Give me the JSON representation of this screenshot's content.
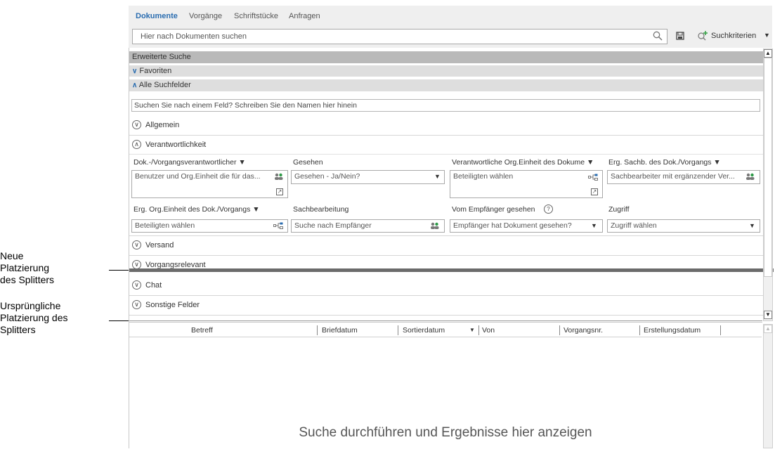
{
  "annotations": {
    "new_placement": [
      "Neue",
      "Platzierung",
      "des Splitters"
    ],
    "original_placement": [
      "Ursprüngliche",
      "Platzierung des",
      "Splitters"
    ]
  },
  "tabs": [
    "Dokumente",
    "Vorgänge",
    "Schriftstücke",
    "Anfragen"
  ],
  "active_tab": "Dokumente",
  "search": {
    "value": "Hier nach Dokumenten suchen",
    "criteria_label": "Suchkriterien"
  },
  "advanced": {
    "header": "Erweiterte Suche",
    "favorites": "Favoriten",
    "all_fields": "Alle Suchfelder",
    "field_search_value": "Suchen Sie nach einem Feld? Schreiben Sie den Namen hier hinein"
  },
  "sections": {
    "allgemein": "Allgemein",
    "verantwortlichkeit": "Verantwortlichkeit",
    "versand": "Versand",
    "vorgangsrelevant": "Vorgangsrelevant",
    "chat": "Chat",
    "sonstige": "Sonstige Felder"
  },
  "fields_row1": [
    {
      "label": "Dok.-/Vorgangsverantwortlicher ▼",
      "value": "Benutzer und Org.Einheit die für das..."
    },
    {
      "label": "Gesehen",
      "value": "Gesehen - Ja/Nein?"
    },
    {
      "label": "Verantwortliche Org.Einheit des Dokume ▼",
      "value": "Beteiligten wählen"
    },
    {
      "label": "Erg. Sachb. des Dok./Vorgangs ▼",
      "value": "Sachbearbeiter mit ergänzender Ver..."
    }
  ],
  "fields_row2": [
    {
      "label": "Erg. Org.Einheit des Dok./Vorgangs ▼",
      "value": "Beteiligten wählen"
    },
    {
      "label": "Sachbearbeitung",
      "value": "Suche nach Empfänger"
    },
    {
      "label": "Vom Empfänger gesehen",
      "value": "Empfänger hat Dokument gesehen?"
    },
    {
      "label": "Zugriff",
      "value": "Zugriff wählen"
    }
  ],
  "help_glyph": "?",
  "results": {
    "columns": [
      "Betreff",
      "Briefdatum",
      "Sortierdatum",
      "Von",
      "Vorgangsnr.",
      "Erstellungsdatum"
    ],
    "empty_message": "Suche durchführen und Ergebnisse hier anzeigen"
  },
  "colors": {
    "accent": "#2a6db0",
    "splitter": "#6b6b6b",
    "band": "#dedede",
    "band_dark": "#b9b9b9"
  }
}
